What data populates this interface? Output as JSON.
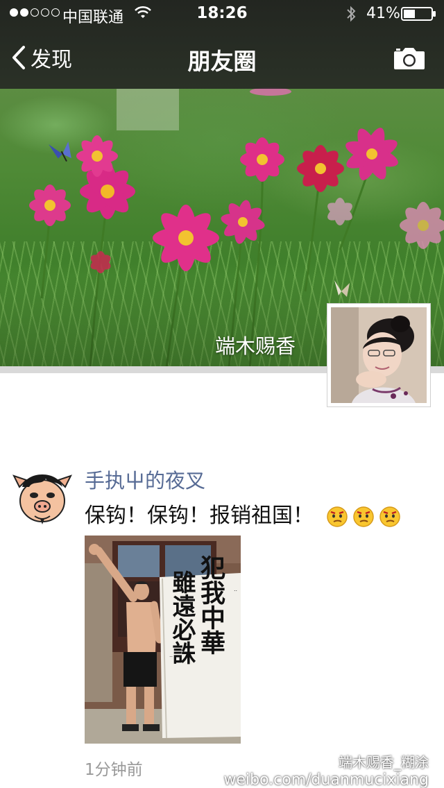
{
  "status_bar": {
    "carrier": "中国联通",
    "time": "18:26",
    "battery": "41%",
    "signal_bars_filled": 2,
    "signal_bars_total": 5
  },
  "navbar": {
    "back_label": "发现",
    "title": "朋友圈",
    "camera_icon": "camera-icon"
  },
  "profile": {
    "name": "端木赐香"
  },
  "post": {
    "author": "手执屮的夜叉",
    "text": "保钩！保钩！报销祖国！",
    "emoji_count": 3,
    "time": "1分钟前",
    "image": {
      "banner_lines": [
        "犯我中華",
        "雖遠必誅"
      ]
    }
  },
  "watermark": {
    "line1": "端木赐香_糊涂",
    "line2": "weibo.com/duanmucixiang"
  },
  "colors": {
    "nav_bg": "#222222",
    "author_link": "#576b95",
    "timestamp": "#999999"
  }
}
